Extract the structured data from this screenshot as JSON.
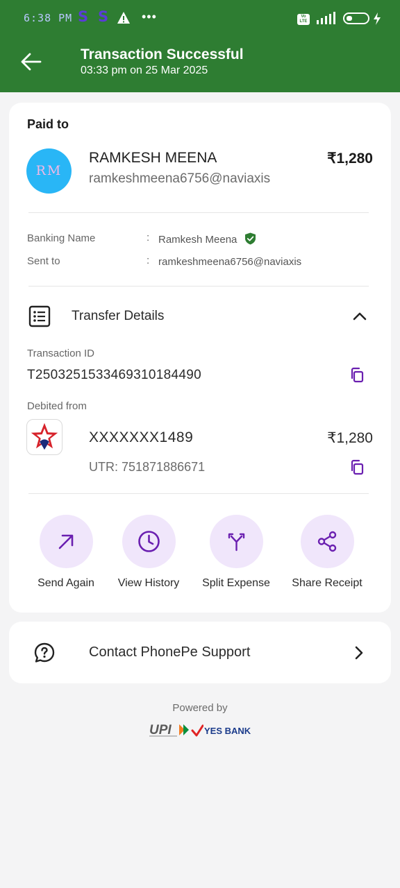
{
  "status_bar": {
    "time": "6:38 PM",
    "notification_icons": [
      "S",
      "S"
    ],
    "volte": "Vo LTE"
  },
  "header": {
    "title": "Transaction Successful",
    "subtitle": "03:33 pm on 25 Mar 2025",
    "color": "#2e7d32"
  },
  "paid_to": {
    "section_label": "Paid to",
    "avatar_initials": "RM",
    "name": "RAMKESH MEENA",
    "vpa": "ramkeshmeena6756@naviaxis",
    "amount": "₹1,280"
  },
  "details": {
    "banking_name_label": "Banking Name",
    "banking_name": "Ramkesh Meena",
    "sent_to_label": "Sent to",
    "sent_to": "ramkeshmeena6756@naviaxis",
    "colon": ":"
  },
  "transfer_details": {
    "label": "Transfer Details",
    "transaction_id_label": "Transaction ID",
    "transaction_id": "T2503251533469310184490",
    "debited_from_label": "Debited from",
    "account": "XXXXXXX1489",
    "utr": "UTR: 751871886671",
    "amount": "₹1,280"
  },
  "actions": [
    {
      "label": "Send Again",
      "icon": "arrow-up-right-icon"
    },
    {
      "label": "View History",
      "icon": "clock-icon"
    },
    {
      "label": "Split Expense",
      "icon": "split-icon"
    },
    {
      "label": "Share Receipt",
      "icon": "share-icon"
    }
  ],
  "support": {
    "label": "Contact PhonePe Support"
  },
  "footer": {
    "powered_by": "Powered by",
    "upi": "UPI",
    "bank": "YES BANK"
  },
  "colors": {
    "accent": "#6a1fb0",
    "action_bg": "#f0e6fb"
  }
}
